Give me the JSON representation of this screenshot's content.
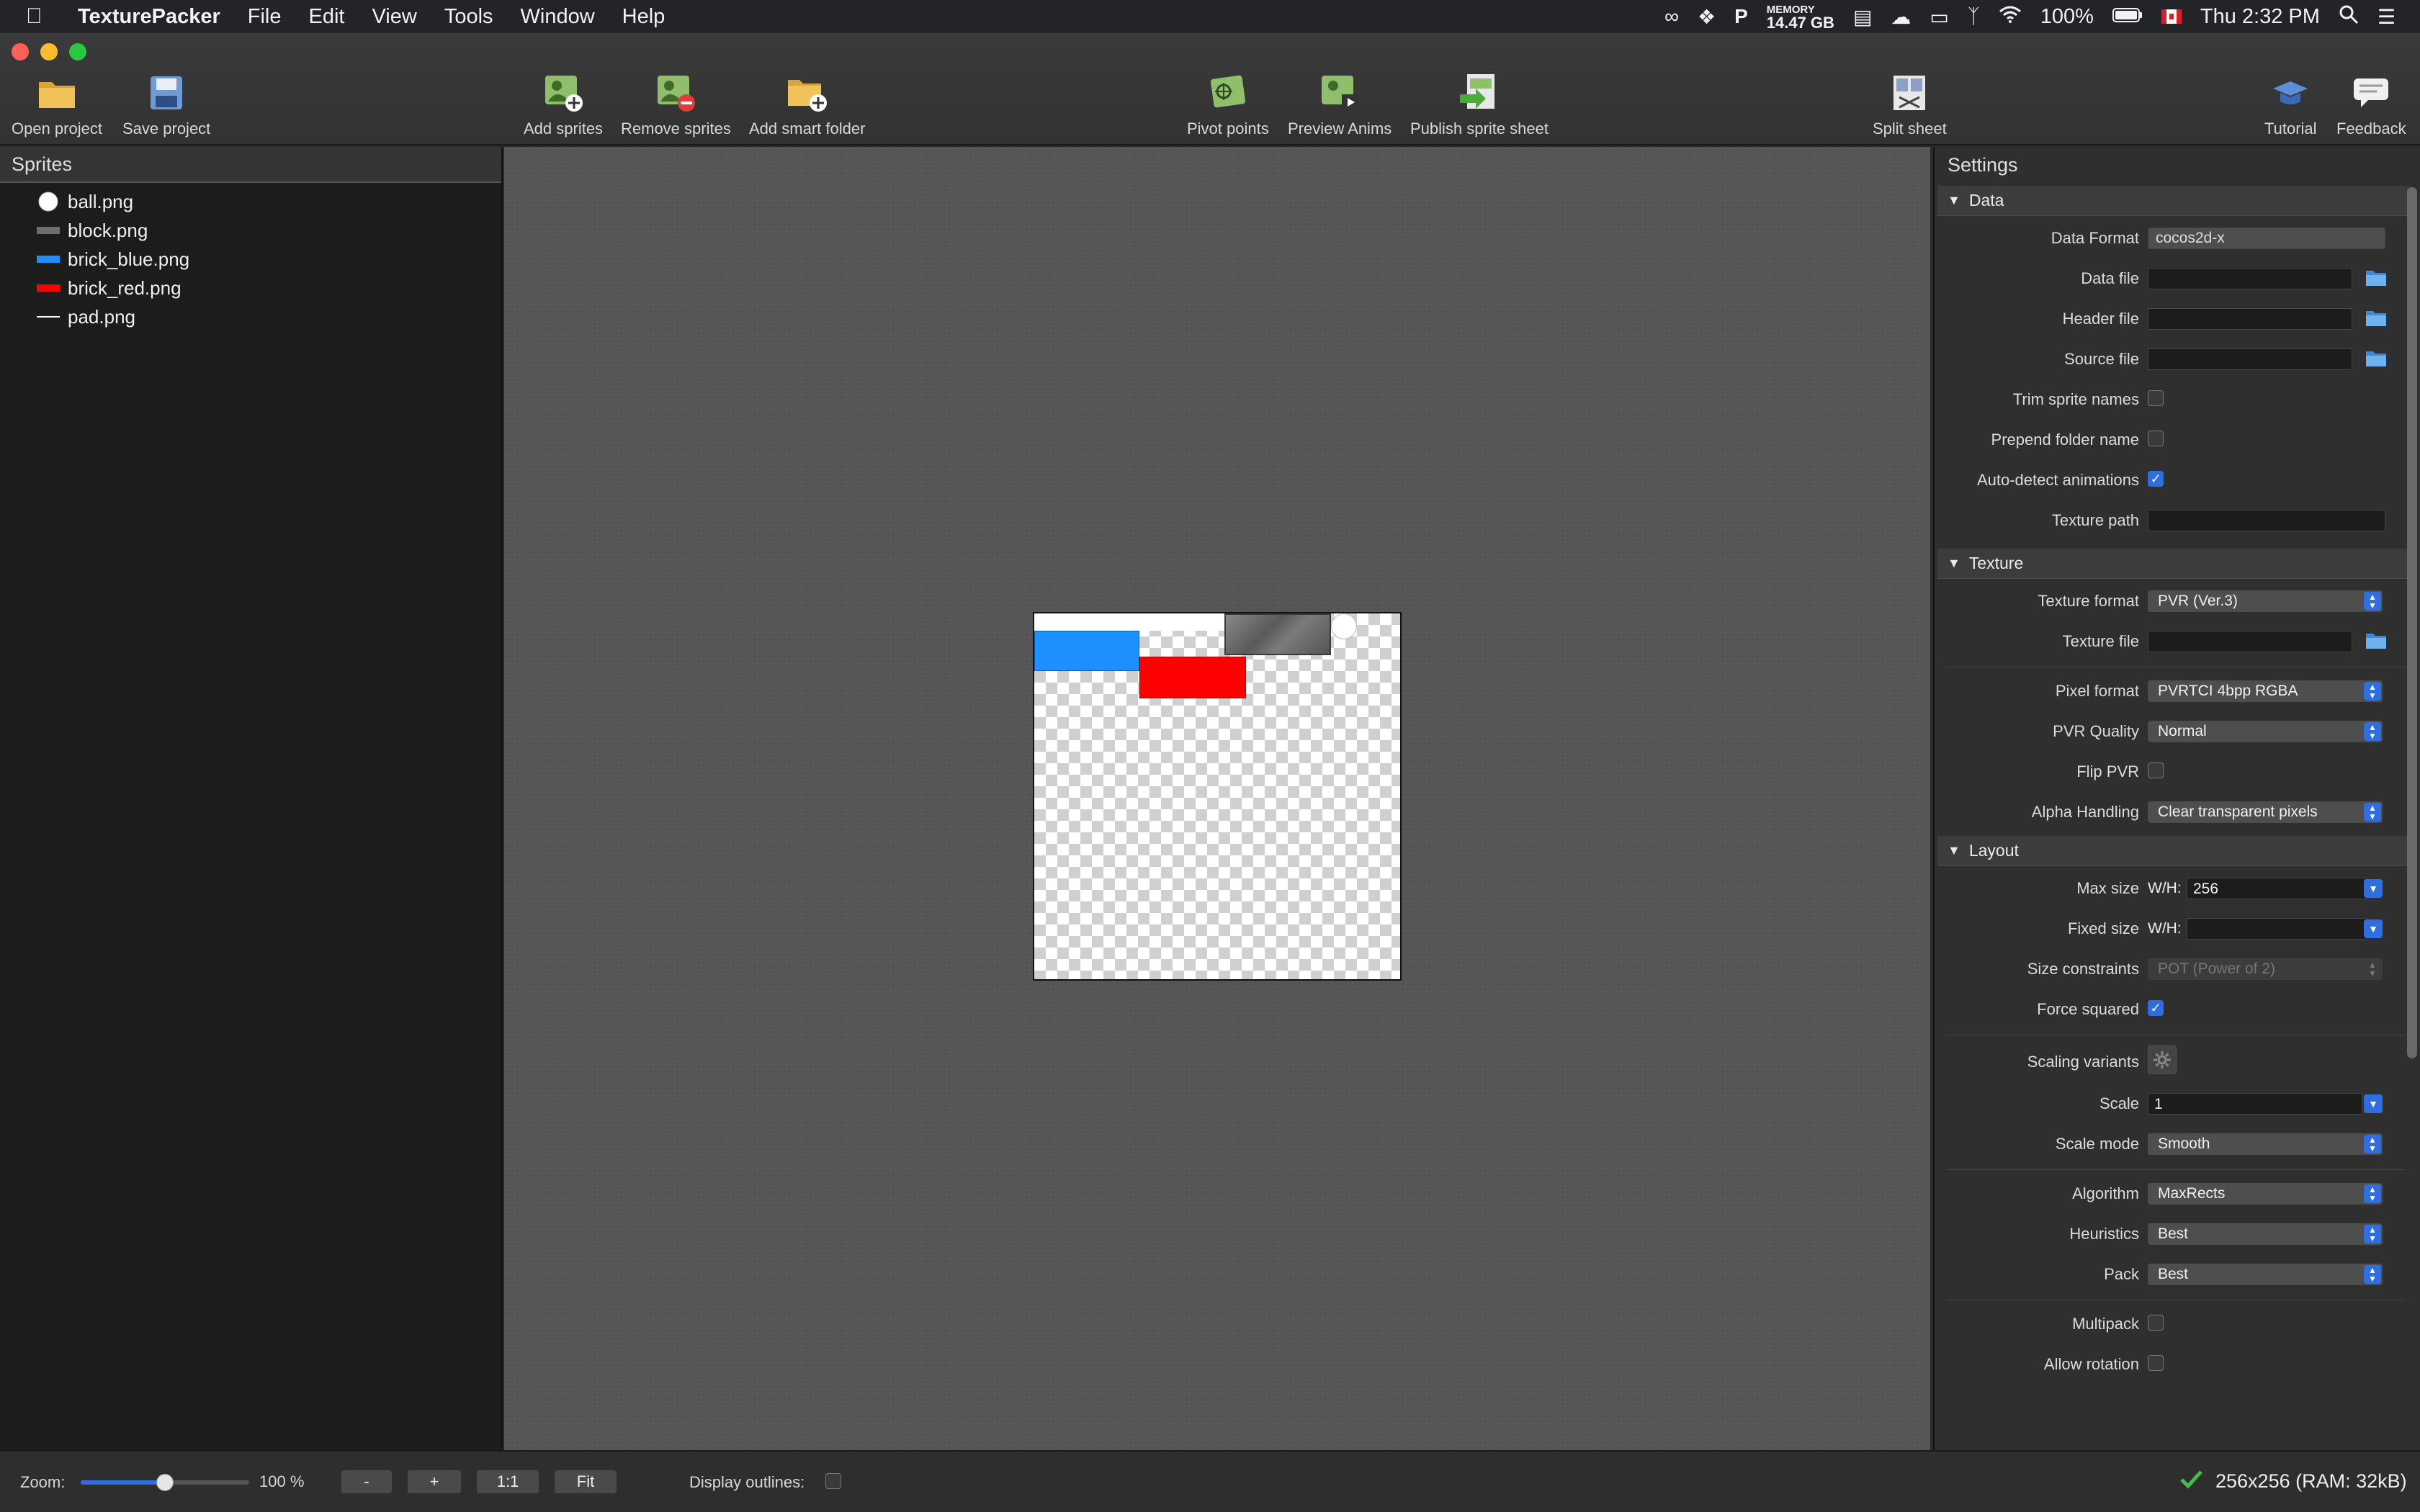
{
  "menubar": {
    "app_name": "TexturePacker",
    "menus": [
      "File",
      "Edit",
      "View",
      "Tools",
      "Window",
      "Help"
    ],
    "memory_label": "MEMORY",
    "memory_value": "14.47 GB",
    "battery": "100%",
    "clock": "Thu 2:32 PM"
  },
  "toolbar": {
    "open_project": "Open project",
    "save_project": "Save project",
    "add_sprites": "Add sprites",
    "remove_sprites": "Remove sprites",
    "add_smart_folder": "Add smart folder",
    "pivot_points": "Pivot points",
    "preview_anims": "Preview Anims",
    "publish_sprite_sheet": "Publish sprite sheet",
    "split_sheet": "Split sheet",
    "tutorial": "Tutorial",
    "feedback": "Feedback"
  },
  "sprites_panel": {
    "title": "Sprites",
    "items": [
      {
        "name": "ball.png",
        "swatch": "#ffffff"
      },
      {
        "name": "block.png",
        "swatch": "#6e6e6e"
      },
      {
        "name": "brick_blue.png",
        "swatch": "#1e8fff"
      },
      {
        "name": "brick_red.png",
        "swatch": "#ff0000"
      },
      {
        "name": "pad.png",
        "swatch": "#ffffff"
      }
    ]
  },
  "settings": {
    "title": "Settings",
    "data_section": {
      "title": "Data",
      "data_format_label": "Data Format",
      "data_format_value": "cocos2d-x",
      "data_file_label": "Data file",
      "header_file_label": "Header file",
      "source_file_label": "Source file",
      "trim_sprite_names_label": "Trim sprite names",
      "prepend_folder_name_label": "Prepend folder name",
      "auto_detect_animations_label": "Auto-detect animations",
      "texture_path_label": "Texture path"
    },
    "texture_section": {
      "title": "Texture",
      "texture_format_label": "Texture format",
      "texture_format_value": "PVR (Ver.3)",
      "texture_file_label": "Texture file",
      "pixel_format_label": "Pixel format",
      "pixel_format_value": "PVRTCI 4bpp RGBA",
      "pvr_quality_label": "PVR Quality",
      "pvr_quality_value": "Normal",
      "flip_pvr_label": "Flip PVR",
      "alpha_handling_label": "Alpha Handling",
      "alpha_handling_value": "Clear transparent pixels"
    },
    "layout_section": {
      "title": "Layout",
      "max_size_label": "Max size",
      "wh_label": "W/H:",
      "max_size_value": "256",
      "fixed_size_label": "Fixed size",
      "size_constraints_label": "Size constraints",
      "size_constraints_value": "POT (Power of 2)",
      "force_squared_label": "Force squared",
      "scaling_variants_label": "Scaling variants",
      "scale_label": "Scale",
      "scale_value": "1",
      "scale_mode_label": "Scale mode",
      "scale_mode_value": "Smooth",
      "algorithm_label": "Algorithm",
      "algorithm_value": "MaxRects",
      "heuristics_label": "Heuristics",
      "heuristics_value": "Best",
      "pack_label": "Pack",
      "pack_value": "Best",
      "multipack_label": "Multipack",
      "allow_rotation_label": "Allow rotation"
    }
  },
  "statusbar": {
    "zoom_label": "Zoom:",
    "zoom_value": "100 %",
    "zoom_level": 0.5,
    "zoom_out": "-",
    "zoom_in": "+",
    "zoom_1_1": "1:1",
    "zoom_fit": "Fit",
    "display_outlines_label": "Display outlines:",
    "size_info": "256x256 (RAM: 32kB)"
  },
  "colors": {
    "accent": "#2e6ee0",
    "brick_blue": "#1e8fff",
    "brick_red": "#ff0000"
  }
}
